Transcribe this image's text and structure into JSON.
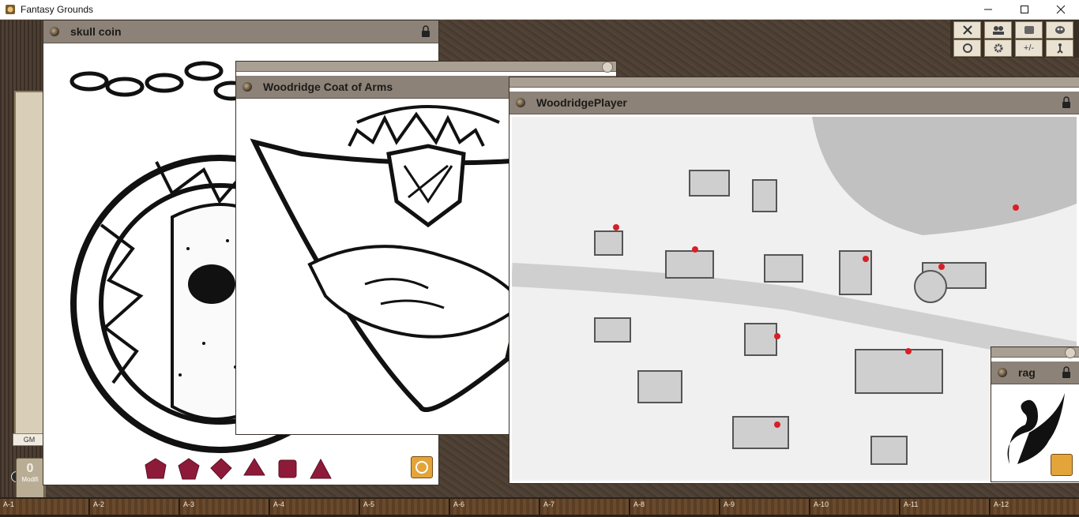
{
  "app": {
    "title": "Fantasy Grounds"
  },
  "left_panel": {
    "gm_label": "GM",
    "modifier_value": "0",
    "modifier_label": "Modifi"
  },
  "windows": {
    "skull_coin": {
      "title": "skull coin"
    },
    "coat_of_arms": {
      "title": "Woodridge Coat of Arms"
    },
    "player_map": {
      "title": "WoodridgePlayer"
    },
    "rag": {
      "title": "rag"
    }
  },
  "toolbar": {
    "buttons": [
      "sword-icon",
      "info-party-icon",
      "scroll-icon",
      "mask-icon",
      "options-icon",
      "gear-icon",
      "plus-minus",
      "walker-icon"
    ],
    "plus_minus_label": "+/-"
  },
  "dice": [
    "d20",
    "d12",
    "d10",
    "d8",
    "d6",
    "d4"
  ],
  "hotkeys": [
    "A-1",
    "A-2",
    "A-3",
    "A-4",
    "A-5",
    "A-6",
    "A-7",
    "A-8",
    "A-9",
    "A-10",
    "A-11",
    "A-12"
  ],
  "colors": {
    "header": "#8c8278",
    "leather": "#4f4034",
    "dice": "#8e1a3a",
    "share": "#e3a43a"
  }
}
